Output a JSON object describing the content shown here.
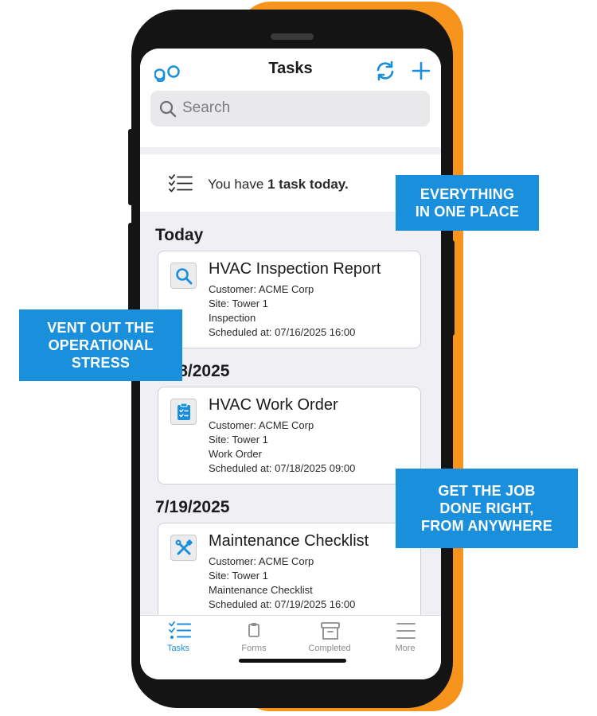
{
  "header": {
    "title": "Tasks"
  },
  "search": {
    "placeholder": "Search"
  },
  "summary": {
    "prefix": "You have ",
    "bold": "1 task today.",
    "suffix": ""
  },
  "groups": [
    {
      "date": "Today"
    },
    {
      "date": "7/18/2025"
    },
    {
      "date": "7/19/2025"
    }
  ],
  "tasks": [
    {
      "title": "HVAC Inspection Report",
      "icon": "search-icon",
      "customer": "Customer: ACME Corp",
      "site": "Site: Tower 1",
      "type": "Inspection",
      "scheduled": "Scheduled at: 07/16/2025 16:00"
    },
    {
      "title": "HVAC Work Order",
      "icon": "clipboard-icon",
      "customer": "Customer: ACME Corp",
      "site": "Site: Tower 1",
      "type": "Work Order",
      "scheduled": "Scheduled at: 07/18/2025 09:00"
    },
    {
      "title": "Maintenance Checklist",
      "icon": "tools-icon",
      "customer": "Customer: ACME Corp",
      "site": "Site: Tower 1",
      "type": "Maintenance Checklist",
      "scheduled": "Scheduled at: 07/19/2025 16:00"
    }
  ],
  "tabs": [
    {
      "label": "Tasks",
      "icon": "tasks-icon",
      "active": true
    },
    {
      "label": "Forms",
      "icon": "forms-icon",
      "active": false
    },
    {
      "label": "Completed",
      "icon": "archive-icon",
      "active": false
    },
    {
      "label": "More",
      "icon": "menu-icon",
      "active": false
    }
  ],
  "callouts": {
    "top": [
      "EVERYTHING",
      "IN ONE PLACE"
    ],
    "left": [
      "VENT OUT THE",
      "OPERATIONAL",
      "STRESS"
    ],
    "bottom": [
      "GET THE JOB",
      "DONE RIGHT,",
      "FROM ANYWHERE"
    ]
  },
  "colors": {
    "accent": "#1a8fdb",
    "orange": "#f7941d",
    "phone": "#141414"
  }
}
